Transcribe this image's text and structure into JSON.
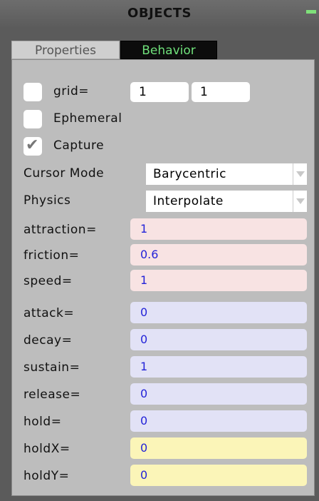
{
  "panel": {
    "title": "OBJECTS"
  },
  "tabs": {
    "properties": "Properties",
    "behavior": "Behavior"
  },
  "grid": {
    "label": "grid=",
    "x": "1",
    "y": "1",
    "checked": false
  },
  "ephemeral": {
    "label": "Ephemeral",
    "checked": false
  },
  "capture": {
    "label": "Capture",
    "checked": true,
    "mark": "✔"
  },
  "cursor_mode": {
    "label": "Cursor Mode",
    "value": "Barycentric"
  },
  "physics": {
    "label": "Physics",
    "value": "Interpolate"
  },
  "params": [
    {
      "label": "attraction=",
      "value": "1",
      "color": "#f8e3e3"
    },
    {
      "label": "friction=",
      "value": "0.6",
      "color": "#f8e3e3"
    },
    {
      "label": "speed=",
      "value": "1",
      "color": "#f8e3e3"
    },
    {
      "label": "attack=",
      "value": "0",
      "color": "#e2e2f6"
    },
    {
      "label": "decay=",
      "value": "0",
      "color": "#e2e2f6"
    },
    {
      "label": "sustain=",
      "value": "1",
      "color": "#e2e2f6"
    },
    {
      "label": "release=",
      "value": "0",
      "color": "#e2e2f6"
    },
    {
      "label": "hold=",
      "value": "0",
      "color": "#e2e2f6"
    },
    {
      "label": "holdX=",
      "value": "0",
      "color": "#fbf5b8"
    },
    {
      "label": "holdY=",
      "value": "0",
      "color": "#fbf5b8"
    }
  ]
}
